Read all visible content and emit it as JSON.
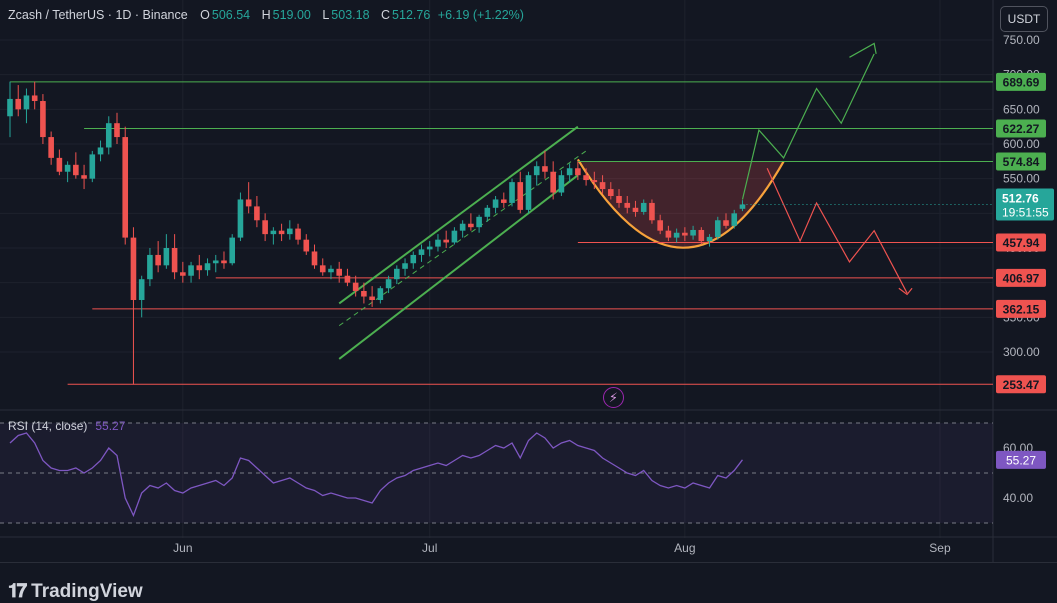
{
  "header": {
    "symbol": "Zcash / TetherUS · 1D · Binance",
    "o_label": "O",
    "o_val": "506.54",
    "h_label": "H",
    "h_val": "519.00",
    "l_label": "L",
    "l_val": "503.18",
    "c_label": "C",
    "c_val": "512.76",
    "change": "+6.19 (+1.22%)"
  },
  "unit": "USDT",
  "brand": "TradingView",
  "colors": {
    "bg": "#131722",
    "up": "#26a69a",
    "down": "#ef5350",
    "green_line": "#4caf50",
    "rsi": "#7e57c2",
    "cup": "#f7a23b"
  },
  "rsi": {
    "label": "RSI (14, close)",
    "value": "55.27"
  },
  "chart_data": [
    {
      "type": "candlestick",
      "ylim": [
        240,
        760
      ],
      "y_ticks": [
        300,
        350,
        400,
        450,
        500,
        550,
        600,
        650,
        700,
        750
      ],
      "y_tick_labels": [
        "300.00",
        "350.00",
        "400.00",
        "450.00",
        "500.00",
        "550.00",
        "600.00",
        "650.00",
        "700.00",
        "750.00"
      ],
      "x_ticks": [
        "Jun",
        "Jul",
        "Aug",
        "Sep"
      ],
      "x_tick_dates": [
        "2025-06-01",
        "2025-07-01",
        "2025-08-01",
        "2025-09-01"
      ],
      "price_levels": [
        {
          "value": 689.69,
          "label": "689.69",
          "color": "#4caf50",
          "from": "2025-05-11"
        },
        {
          "value": 622.27,
          "label": "622.27",
          "color": "#4caf50",
          "from": "2025-05-20"
        },
        {
          "value": 574.84,
          "label": "574.84",
          "color": "#4caf50",
          "from": "2025-07-19"
        },
        {
          "value": 457.94,
          "label": "457.94",
          "color": "#ef5350",
          "from": "2025-07-19"
        },
        {
          "value": 406.97,
          "label": "406.97",
          "color": "#ef5350",
          "from": "2025-06-05"
        },
        {
          "value": 362.15,
          "label": "362.15",
          "color": "#ef5350",
          "from": "2025-05-21"
        },
        {
          "value": 253.47,
          "label": "253.47",
          "color": "#ef5350",
          "from": "2025-05-18"
        }
      ],
      "last_price": {
        "value": 512.76,
        "label": "512.76",
        "countdown": "19:51:55"
      },
      "candles_ohlc": [
        [
          "2025-05-11",
          640,
          690,
          610,
          665
        ],
        [
          "2025-05-12",
          665,
          685,
          640,
          650
        ],
        [
          "2025-05-13",
          650,
          680,
          630,
          670
        ],
        [
          "2025-05-14",
          670,
          690,
          650,
          662
        ],
        [
          "2025-05-15",
          662,
          672,
          600,
          610
        ],
        [
          "2025-05-16",
          610,
          618,
          570,
          580
        ],
        [
          "2025-05-17",
          580,
          592,
          555,
          560
        ],
        [
          "2025-05-18",
          560,
          575,
          545,
          570
        ],
        [
          "2025-05-19",
          570,
          588,
          550,
          555
        ],
        [
          "2025-05-20",
          555,
          570,
          535,
          550
        ],
        [
          "2025-05-21",
          550,
          590,
          545,
          585
        ],
        [
          "2025-05-22",
          585,
          605,
          575,
          595
        ],
        [
          "2025-05-23",
          595,
          640,
          585,
          630
        ],
        [
          "2025-05-24",
          630,
          645,
          600,
          610
        ],
        [
          "2025-05-25",
          610,
          625,
          455,
          465
        ],
        [
          "2025-05-26",
          465,
          480,
          253,
          375
        ],
        [
          "2025-05-27",
          375,
          410,
          350,
          405
        ],
        [
          "2025-05-28",
          405,
          450,
          395,
          440
        ],
        [
          "2025-05-29",
          440,
          460,
          415,
          425
        ],
        [
          "2025-05-30",
          425,
          470,
          420,
          450
        ],
        [
          "2025-05-31",
          450,
          470,
          405,
          415
        ],
        [
          "2025-06-01",
          415,
          430,
          400,
          410
        ],
        [
          "2025-06-02",
          410,
          430,
          400,
          425
        ],
        [
          "2025-06-03",
          425,
          440,
          405,
          418
        ],
        [
          "2025-06-04",
          418,
          435,
          410,
          428
        ],
        [
          "2025-06-05",
          428,
          440,
          415,
          432
        ],
        [
          "2025-06-06",
          432,
          445,
          420,
          428
        ],
        [
          "2025-06-07",
          428,
          470,
          425,
          465
        ],
        [
          "2025-06-08",
          465,
          530,
          460,
          520
        ],
        [
          "2025-06-09",
          520,
          545,
          500,
          510
        ],
        [
          "2025-06-10",
          510,
          525,
          480,
          490
        ],
        [
          "2025-06-11",
          490,
          500,
          460,
          470
        ],
        [
          "2025-06-12",
          470,
          480,
          455,
          475
        ],
        [
          "2025-06-13",
          475,
          485,
          460,
          470
        ],
        [
          "2025-06-14",
          470,
          490,
          462,
          478
        ],
        [
          "2025-06-15",
          478,
          485,
          455,
          462
        ],
        [
          "2025-06-16",
          462,
          470,
          440,
          445
        ],
        [
          "2025-06-17",
          445,
          455,
          420,
          425
        ],
        [
          "2025-06-18",
          425,
          435,
          410,
          415
        ],
        [
          "2025-06-19",
          415,
          425,
          405,
          420
        ],
        [
          "2025-06-20",
          420,
          430,
          400,
          410
        ],
        [
          "2025-06-21",
          410,
          420,
          395,
          400
        ],
        [
          "2025-06-22",
          400,
          410,
          380,
          388
        ],
        [
          "2025-06-23",
          388,
          400,
          370,
          380
        ],
        [
          "2025-06-24",
          380,
          395,
          365,
          375
        ],
        [
          "2025-06-25",
          375,
          395,
          370,
          392
        ],
        [
          "2025-06-26",
          392,
          410,
          385,
          405
        ],
        [
          "2025-06-27",
          405,
          425,
          398,
          420
        ],
        [
          "2025-06-28",
          420,
          435,
          410,
          428
        ],
        [
          "2025-06-29",
          428,
          445,
          420,
          440
        ],
        [
          "2025-06-30",
          440,
          455,
          430,
          448
        ],
        [
          "2025-07-01",
          448,
          460,
          438,
          452
        ],
        [
          "2025-07-02",
          452,
          470,
          445,
          462
        ],
        [
          "2025-07-03",
          462,
          475,
          450,
          458
        ],
        [
          "2025-07-04",
          458,
          480,
          455,
          475
        ],
        [
          "2025-07-05",
          475,
          490,
          465,
          485
        ],
        [
          "2025-07-06",
          485,
          500,
          475,
          480
        ],
        [
          "2025-07-07",
          480,
          498,
          472,
          495
        ],
        [
          "2025-07-08",
          495,
          512,
          488,
          508
        ],
        [
          "2025-07-09",
          508,
          525,
          500,
          520
        ],
        [
          "2025-07-10",
          520,
          530,
          508,
          515
        ],
        [
          "2025-07-11",
          515,
          550,
          510,
          545
        ],
        [
          "2025-07-12",
          545,
          560,
          500,
          505
        ],
        [
          "2025-07-13",
          505,
          560,
          500,
          555
        ],
        [
          "2025-07-14",
          555,
          575,
          540,
          568
        ],
        [
          "2025-07-15",
          568,
          590,
          550,
          560
        ],
        [
          "2025-07-16",
          560,
          575,
          520,
          530
        ],
        [
          "2025-07-17",
          530,
          562,
          525,
          555
        ],
        [
          "2025-07-18",
          555,
          572,
          545,
          565
        ],
        [
          "2025-07-19",
          565,
          575,
          548,
          555
        ],
        [
          "2025-07-20",
          555,
          565,
          540,
          548
        ],
        [
          "2025-07-21",
          548,
          560,
          535,
          545
        ],
        [
          "2025-07-22",
          545,
          555,
          528,
          535
        ],
        [
          "2025-07-23",
          535,
          545,
          520,
          525
        ],
        [
          "2025-07-24",
          525,
          535,
          508,
          515
        ],
        [
          "2025-07-25",
          515,
          525,
          500,
          508
        ],
        [
          "2025-07-26",
          508,
          518,
          495,
          502
        ],
        [
          "2025-07-27",
          502,
          520,
          498,
          515
        ],
        [
          "2025-07-28",
          515,
          520,
          485,
          490
        ],
        [
          "2025-07-29",
          490,
          498,
          470,
          475
        ],
        [
          "2025-07-30",
          475,
          482,
          460,
          465
        ],
        [
          "2025-07-31",
          465,
          478,
          458,
          472
        ],
        [
          "2025-08-01",
          472,
          480,
          460,
          468
        ],
        [
          "2025-08-02",
          468,
          482,
          462,
          476
        ],
        [
          "2025-08-03",
          476,
          480,
          455,
          460
        ],
        [
          "2025-08-04",
          460,
          470,
          452,
          466
        ],
        [
          "2025-08-05",
          466,
          495,
          462,
          490
        ],
        [
          "2025-08-06",
          490,
          500,
          478,
          482
        ],
        [
          "2025-08-07",
          482,
          505,
          478,
          500
        ],
        [
          "2025-08-08",
          506.54,
          519,
          503.18,
          512.76
        ]
      ],
      "rsi_values": [
        62,
        65,
        66,
        62,
        55,
        52,
        51,
        51,
        52,
        50,
        52,
        55,
        60,
        57,
        40,
        33,
        42,
        45,
        44,
        46,
        43,
        42,
        44,
        45,
        46,
        47,
        45,
        48,
        56,
        55,
        52,
        49,
        46,
        47,
        48,
        46,
        44,
        43,
        41,
        42,
        41,
        40,
        40,
        39,
        38,
        43,
        46,
        48,
        49,
        51,
        52,
        53,
        54,
        53,
        55,
        57,
        56,
        57,
        59,
        61,
        60,
        62,
        56,
        63,
        66,
        64,
        60,
        62,
        63,
        61,
        60,
        59,
        56,
        54,
        52,
        50,
        49,
        51,
        47,
        45,
        44,
        45,
        44,
        46,
        45,
        44,
        49,
        48,
        51,
        55.27
      ],
      "rsi_ylim": [
        28,
        75
      ],
      "rsi_ticks": [
        40,
        60
      ],
      "rsi_tick_labels": [
        "40.00",
        "60.00"
      ]
    }
  ]
}
